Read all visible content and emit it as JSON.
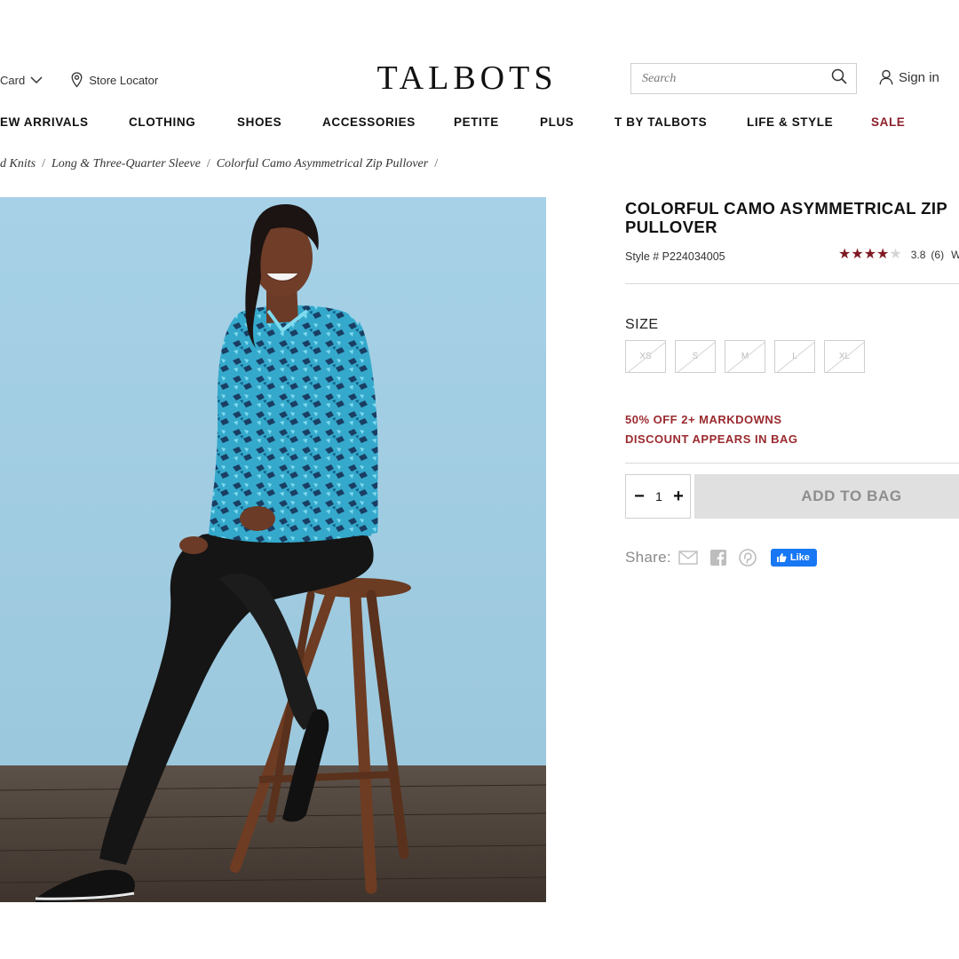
{
  "header": {
    "card_label": "Card",
    "store_locator_label": "Store Locator",
    "logo_text": "TALBOTS",
    "search_placeholder": "Search",
    "sign_in_label": "Sign in"
  },
  "nav": {
    "items": [
      {
        "label": "EW ARRIVALS"
      },
      {
        "label": "CLOTHING"
      },
      {
        "label": "SHOES"
      },
      {
        "label": "ACCESSORIES"
      },
      {
        "label": "PETITE"
      },
      {
        "label": "PLUS"
      },
      {
        "label": "T BY TALBOTS"
      },
      {
        "label": "LIFE & STYLE"
      },
      {
        "label": "SALE"
      }
    ]
  },
  "breadcrumb": {
    "items": [
      "d Knits",
      "Long & Three-Quarter Sleeve",
      "Colorful Camo Asymmetrical Zip Pullover"
    ],
    "separator": "/"
  },
  "product": {
    "title": "COLORFUL CAMO ASYMMETRICAL ZIP PULLOVER",
    "style_text": "Style # P224034005",
    "rating_value": "3.8",
    "rating_stars": 3.8,
    "review_count": "(6)",
    "rating_more": "W",
    "size_label": "SIZE",
    "sizes": [
      "XS",
      "S",
      "M",
      "L",
      "XL"
    ],
    "promo_line1": "50% OFF 2+ MARKDOWNS",
    "promo_line2": "DISCOUNT APPEARS IN BAG",
    "quantity": "1",
    "qty_minus": "−",
    "qty_plus": "+",
    "add_to_bag_label": "ADD TO BAG",
    "share_label": "Share:",
    "fb_like_label": "Like"
  },
  "colors": {
    "sale_red": "#8c1e2a",
    "promo_red": "#9a2a2e",
    "star_red": "#7e1922",
    "add_bag_bg": "#e0e0e0",
    "image_backdrop": "#a9d3e8",
    "facebook_blue": "#1877f2"
  },
  "icons": {
    "card_chevron": "chevron-down-icon",
    "store": "map-pin-icon",
    "search": "search-icon",
    "user": "user-icon",
    "email": "email-icon",
    "facebook": "facebook-icon",
    "pinterest": "pinterest-icon",
    "like": "thumbs-up-icon"
  }
}
